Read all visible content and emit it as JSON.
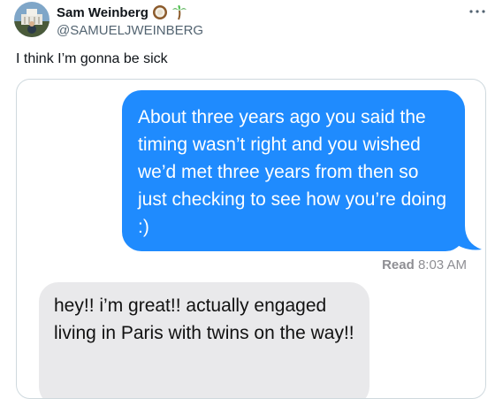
{
  "author": {
    "display_name": "Sam Weinberg",
    "handle": "@SAMUELJWEINBERG",
    "badges": [
      "coconut-emoji",
      "palm-tree-emoji"
    ],
    "avatar": "avatar-photo"
  },
  "more_icon": "more-horizontal-icon",
  "tweet": {
    "text": "I think I’m gonna be sick"
  },
  "screenshot": {
    "sent_message": "About three years ago you said the timing wasn’t right and you wished we’d met three years from then so just checking to see how you’re doing :)",
    "receipt_status": "Read",
    "receipt_time": "8:03 AM",
    "received_message": "hey!! i’m great!! actually engaged living in Paris with twins on the way!!"
  },
  "colors": {
    "sent_bubble": "#1f8bfe",
    "received_bubble": "#e9e9eb",
    "handle_text": "#536471",
    "card_border": "#cfd9de"
  }
}
